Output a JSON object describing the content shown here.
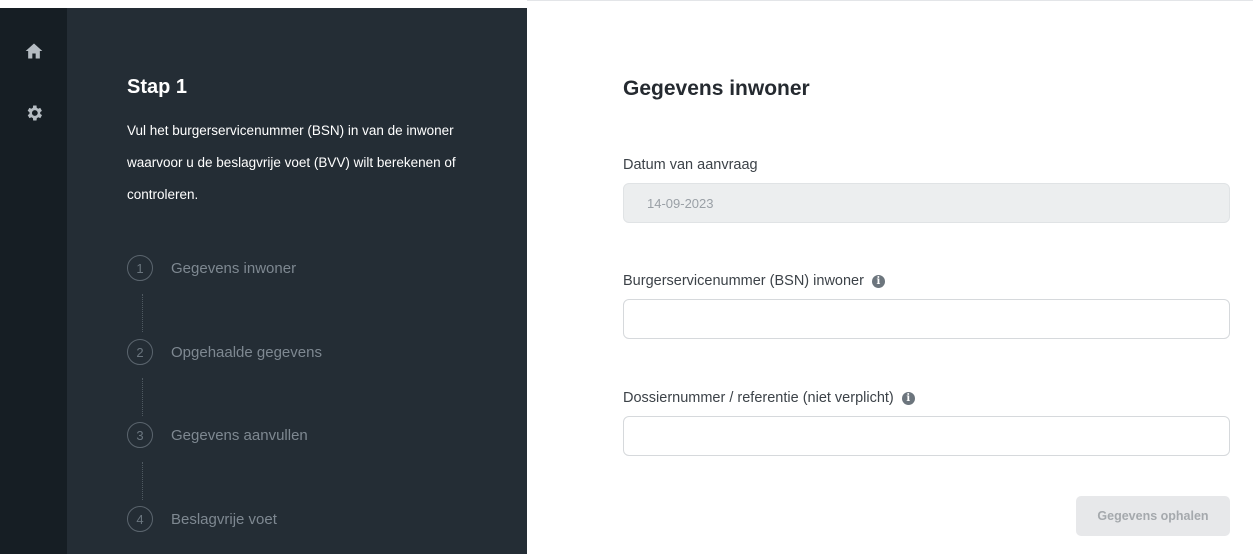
{
  "rail": {
    "icons": [
      "home-icon",
      "gear-icon"
    ]
  },
  "steps_panel": {
    "title": "Stap 1",
    "description": "Vul het burgerservicenummer (BSN) in van de inwoner waarvoor u de beslagvrije voet (BVV) wilt berekenen of controleren.",
    "steps": [
      {
        "number": "1",
        "label": "Gegevens inwoner"
      },
      {
        "number": "2",
        "label": "Opgehaalde gegevens"
      },
      {
        "number": "3",
        "label": "Gegevens aanvullen"
      },
      {
        "number": "4",
        "label": "Beslagvrije voet"
      }
    ]
  },
  "form": {
    "title": "Gegevens inwoner",
    "date_label": "Datum van aanvraag",
    "date_value": "14-09-2023",
    "bsn_label": "Burgerservicenummer (BSN) inwoner",
    "bsn_value": "",
    "dossier_label": "Dossiernummer / referentie (niet verplicht)",
    "dossier_value": "",
    "submit_label": "Gegevens ophalen",
    "info_glyph": "i"
  },
  "colors": {
    "rail_bg": "#161e24",
    "panel_bg": "#242d35",
    "button_disabled_bg": "#e7e8ea"
  }
}
